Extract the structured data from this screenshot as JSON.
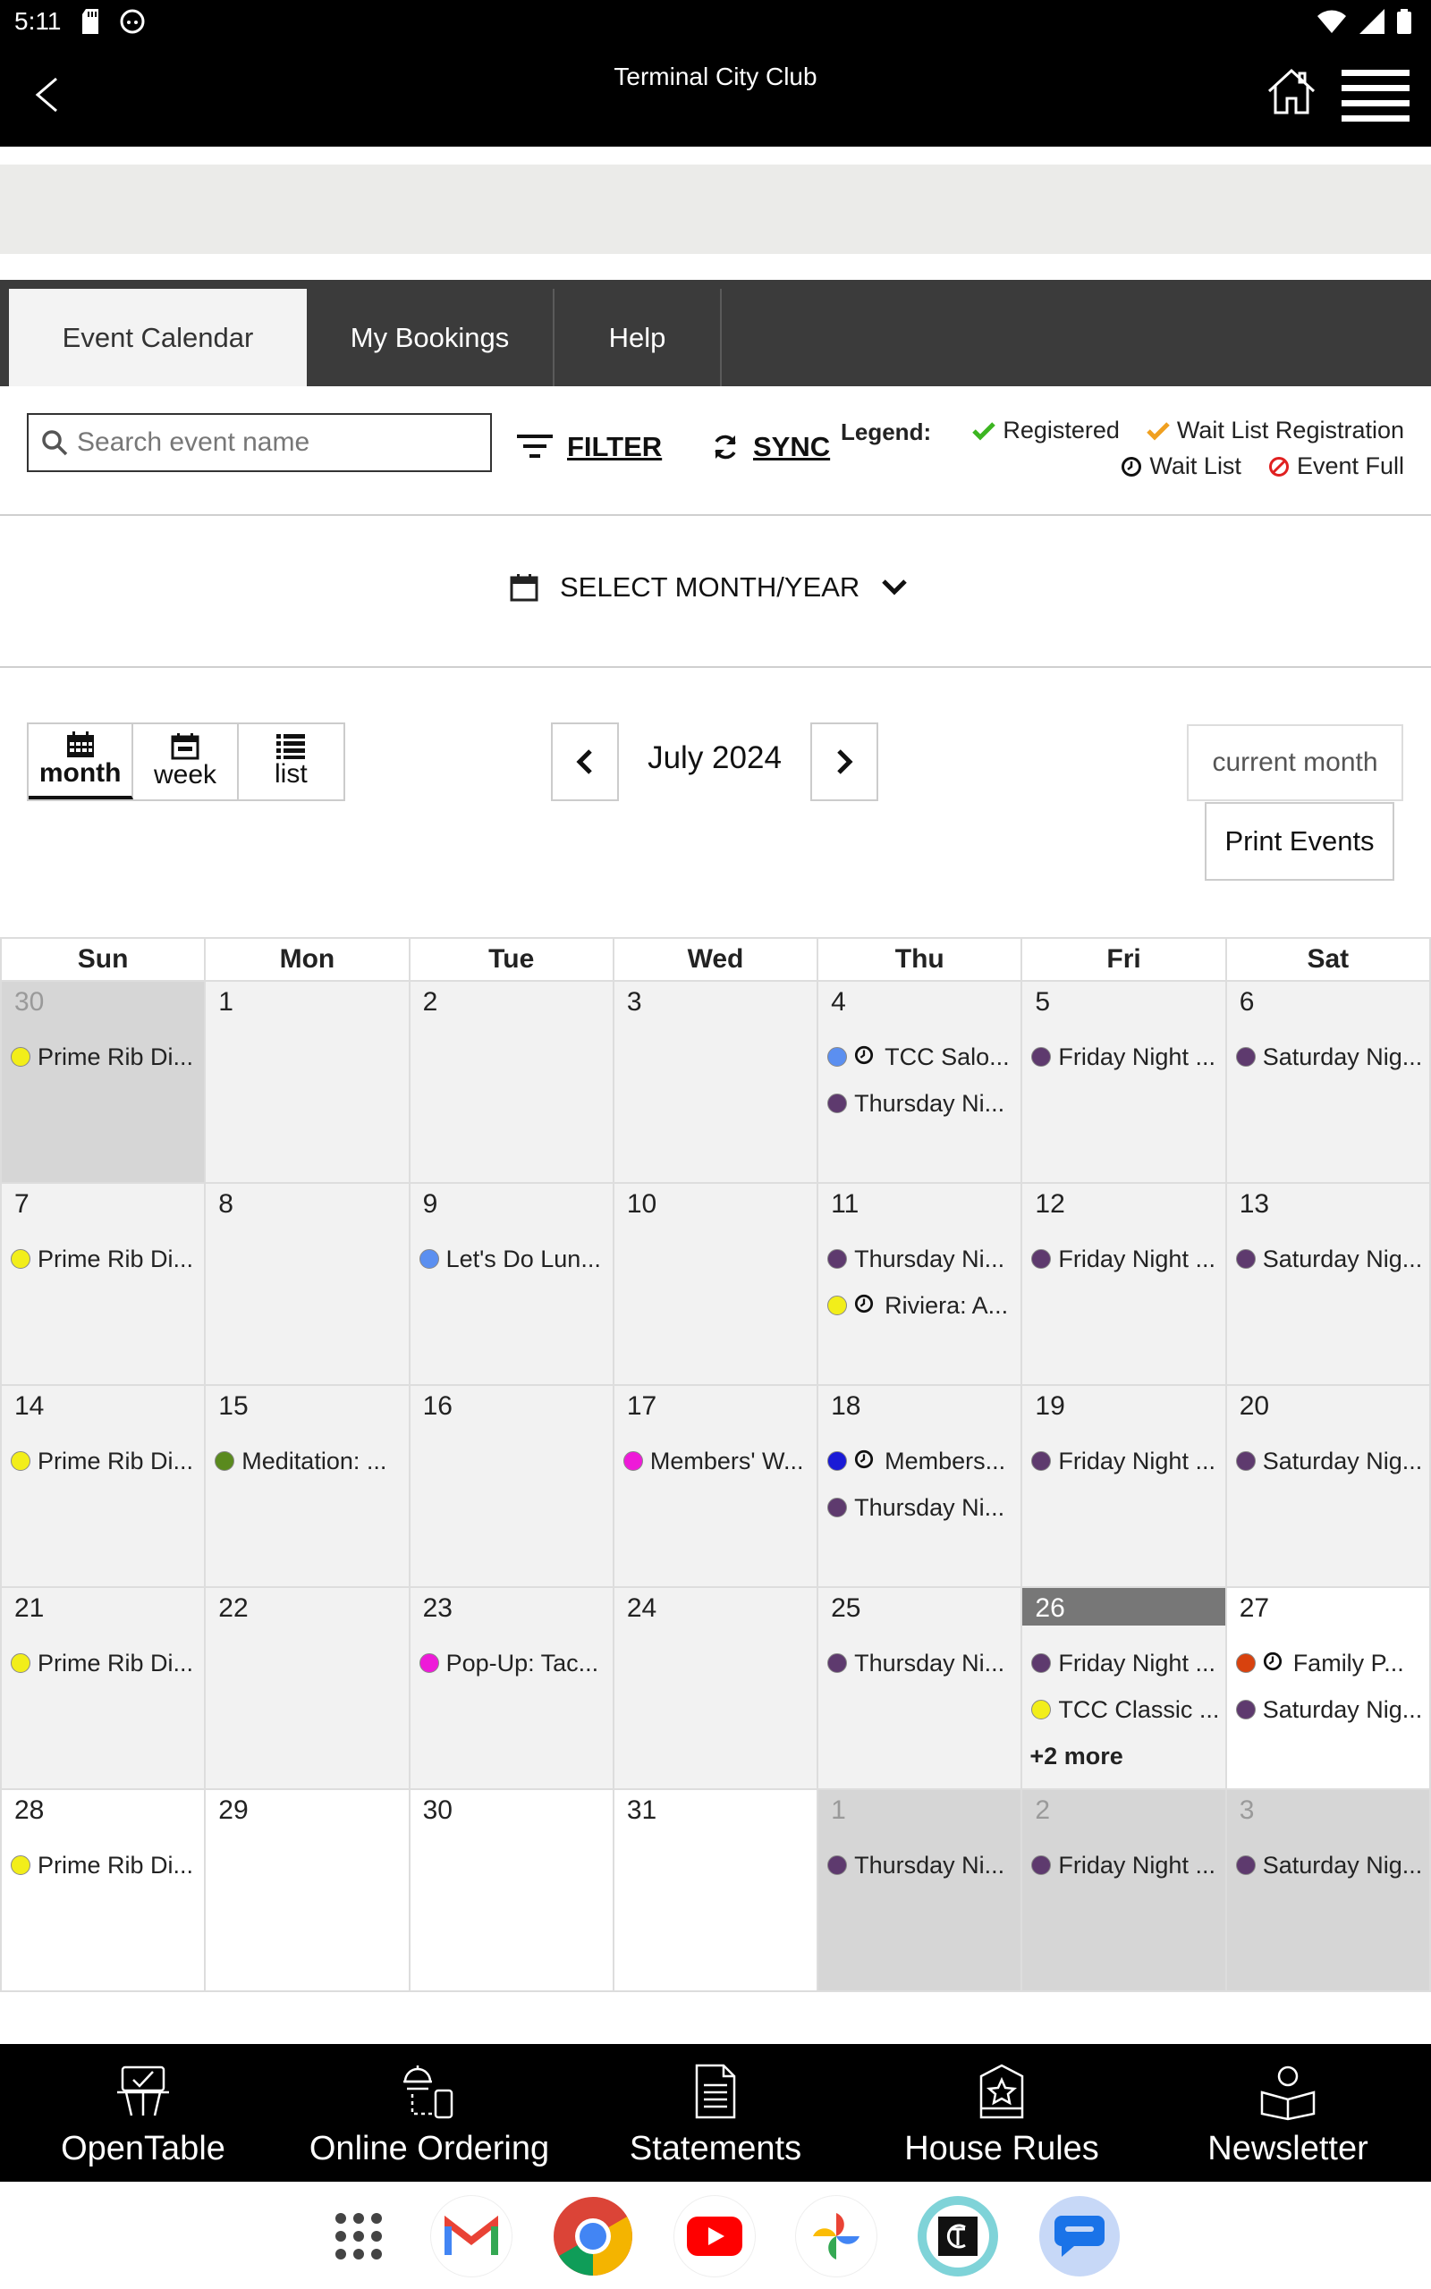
{
  "status_bar": {
    "time": "5:11"
  },
  "header": {
    "title": "Terminal City Club"
  },
  "tabs": [
    {
      "label": "Event Calendar",
      "active": true
    },
    {
      "label": "My Bookings",
      "active": false
    },
    {
      "label": "Help",
      "active": false
    }
  ],
  "toolbar": {
    "search_placeholder": "Search event name",
    "filter_label": "FILTER",
    "sync_label": "SYNC",
    "legend_title": "Legend:",
    "legend": {
      "registered": "Registered",
      "waitlist_registration": "Wait List Registration",
      "waitlist": "Wait List",
      "event_full": "Event Full"
    }
  },
  "month_select": {
    "label": "SELECT MONTH/YEAR"
  },
  "view": {
    "month_label": "month",
    "week_label": "week",
    "list_label": "list",
    "current_period": "July 2024",
    "current_month_label": "current month",
    "print_label": "Print Events"
  },
  "calendar": {
    "weekdays": [
      "Sun",
      "Mon",
      "Tue",
      "Wed",
      "Thu",
      "Fri",
      "Sat"
    ],
    "more_label": "+2 more",
    "weeks": [
      [
        {
          "day": "30",
          "kind": "other",
          "events": [
            {
              "text": "Prime Rib Di...",
              "color": "#f2ee1a"
            }
          ]
        },
        {
          "day": "1",
          "events": []
        },
        {
          "day": "2",
          "events": []
        },
        {
          "day": "3",
          "events": []
        },
        {
          "day": "4",
          "events": [
            {
              "text": "TCC Salo...",
              "color": "#5b8ff0",
              "waitlist": true
            },
            {
              "text": "Thursday Ni...",
              "color": "#5e3a6e"
            }
          ]
        },
        {
          "day": "5",
          "events": [
            {
              "text": "Friday Night ...",
              "color": "#5e3a6e"
            }
          ]
        },
        {
          "day": "6",
          "events": [
            {
              "text": "Saturday Nig...",
              "color": "#5e3a6e"
            }
          ]
        }
      ],
      [
        {
          "day": "7",
          "events": [
            {
              "text": "Prime Rib Di...",
              "color": "#f2ee1a"
            }
          ]
        },
        {
          "day": "8",
          "events": []
        },
        {
          "day": "9",
          "events": [
            {
              "text": "Let's Do Lun...",
              "color": "#5b8ff0"
            }
          ]
        },
        {
          "day": "10",
          "events": []
        },
        {
          "day": "11",
          "events": [
            {
              "text": "Thursday Ni...",
              "color": "#5e3a6e"
            },
            {
              "text": "Riviera: A...",
              "color": "#f2ee1a",
              "waitlist": true
            }
          ]
        },
        {
          "day": "12",
          "events": [
            {
              "text": "Friday Night ...",
              "color": "#5e3a6e"
            }
          ]
        },
        {
          "day": "13",
          "events": [
            {
              "text": "Saturday Nig...",
              "color": "#5e3a6e"
            }
          ]
        }
      ],
      [
        {
          "day": "14",
          "events": [
            {
              "text": "Prime Rib Di...",
              "color": "#f2ee1a"
            }
          ]
        },
        {
          "day": "15",
          "events": [
            {
              "text": "Meditation: ...",
              "color": "#5a8a1e"
            }
          ]
        },
        {
          "day": "16",
          "events": []
        },
        {
          "day": "17",
          "events": [
            {
              "text": "Members' W...",
              "color": "#ee1ad8"
            }
          ]
        },
        {
          "day": "18",
          "events": [
            {
              "text": "Members...",
              "color": "#1a1ad6",
              "waitlist": true
            },
            {
              "text": "Thursday Ni...",
              "color": "#5e3a6e"
            }
          ]
        },
        {
          "day": "19",
          "events": [
            {
              "text": "Friday Night ...",
              "color": "#5e3a6e"
            }
          ]
        },
        {
          "day": "20",
          "events": [
            {
              "text": "Saturday Nig...",
              "color": "#5e3a6e"
            }
          ]
        }
      ],
      [
        {
          "day": "21",
          "events": [
            {
              "text": "Prime Rib Di...",
              "color": "#f2ee1a"
            }
          ]
        },
        {
          "day": "22",
          "events": []
        },
        {
          "day": "23",
          "events": [
            {
              "text": "Pop-Up: Tac...",
              "color": "#ee1ad8"
            }
          ]
        },
        {
          "day": "24",
          "events": []
        },
        {
          "day": "25",
          "events": [
            {
              "text": "Thursday Ni...",
              "color": "#5e3a6e"
            }
          ]
        },
        {
          "day": "26",
          "kind": "today",
          "more": true,
          "events": [
            {
              "text": "Friday Night ...",
              "color": "#5e3a6e"
            },
            {
              "text": "TCC Classic ...",
              "color": "#f2ee1a"
            }
          ]
        },
        {
          "day": "27",
          "kind": "future",
          "events": [
            {
              "text": "Family P...",
              "color": "#d8420e",
              "waitlist": true
            },
            {
              "text": "Saturday Nig...",
              "color": "#5e3a6e"
            }
          ]
        }
      ],
      [
        {
          "day": "28",
          "kind": "future",
          "events": [
            {
              "text": "Prime Rib Di...",
              "color": "#f2ee1a"
            }
          ]
        },
        {
          "day": "29",
          "kind": "future",
          "events": []
        },
        {
          "day": "30",
          "kind": "future",
          "events": []
        },
        {
          "day": "31",
          "kind": "future",
          "events": []
        },
        {
          "day": "1",
          "kind": "other",
          "events": [
            {
              "text": "Thursday Ni...",
              "color": "#5e3a6e"
            }
          ]
        },
        {
          "day": "2",
          "kind": "other",
          "events": [
            {
              "text": "Friday Night ...",
              "color": "#5e3a6e"
            }
          ]
        },
        {
          "day": "3",
          "kind": "other",
          "events": [
            {
              "text": "Saturday Nig...",
              "color": "#5e3a6e"
            }
          ]
        }
      ]
    ]
  },
  "bottom_nav": [
    {
      "label": "OpenTable",
      "icon": "opentable-icon"
    },
    {
      "label": "Online Ordering",
      "icon": "ordering-icon"
    },
    {
      "label": "Statements",
      "icon": "document-icon"
    },
    {
      "label": "House Rules",
      "icon": "rules-icon"
    },
    {
      "label": "Newsletter",
      "icon": "newsletter-icon"
    }
  ],
  "dock": [
    {
      "icon": "app-drawer-icon"
    },
    {
      "icon": "gmail-icon"
    },
    {
      "icon": "chrome-icon"
    },
    {
      "icon": "youtube-icon"
    },
    {
      "icon": "photos-icon"
    },
    {
      "icon": "tcc-app-icon"
    },
    {
      "icon": "messages-icon"
    }
  ],
  "colors": {
    "header_bg": "#000000",
    "tabs_bg": "#3b3b3b",
    "registered_check": "#3cb521",
    "waitlist_registration_check": "#f0a020",
    "event_full": "#e02020"
  }
}
